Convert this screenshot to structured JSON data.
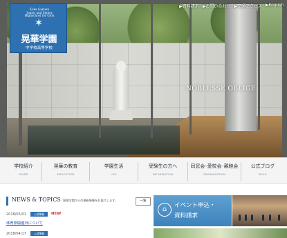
{
  "header": {
    "school_latin": "Koka Gakuen\nJunior and Senior\nHighschool for Girls",
    "school_name": "晃華学園",
    "school_sub": "中学校高等学校",
    "tagline": "NOBLESSE OBLIGE",
    "top_links": [
      "▶資料請求",
      "▶お問い合わせ",
      "▶交通アクセス",
      "▶English"
    ]
  },
  "navigation": [
    {
      "jp": "学校紹介",
      "en": "GUIDE"
    },
    {
      "jp": "晃華の教育",
      "en": "EDUCATION"
    },
    {
      "jp": "学園生活",
      "en": "LIFE"
    },
    {
      "jp": "受験生の方へ",
      "en": "INFORMATION"
    },
    {
      "jp": "同窓会･愛校会･親睦会",
      "en": "ORGANIZATION"
    },
    {
      "jp": "公式ブログ",
      "en": "BLOG"
    }
  ],
  "news": {
    "title": "NEWS & TOPICS",
    "subtitle": "晃華学園からの最新情報をお届けします。",
    "more": "一覧",
    "rows": [
      {
        "date": "2018/05/01",
        "badge": "入試情報",
        "new": "NEW"
      },
      {
        "date": "2018/04/17",
        "badge": "入試情報",
        "new": ""
      }
    ],
    "link_text": "体育祭開催日について"
  },
  "event": {
    "line1": "イベント申込・",
    "line2": "資料請求"
  },
  "colors": {
    "brand_blue": "#2e71b1",
    "event_blue": "#4b8ec6",
    "new_red": "#c6383b"
  },
  "icons": {
    "logo": "star-cross-icon",
    "event": "document-icon"
  }
}
